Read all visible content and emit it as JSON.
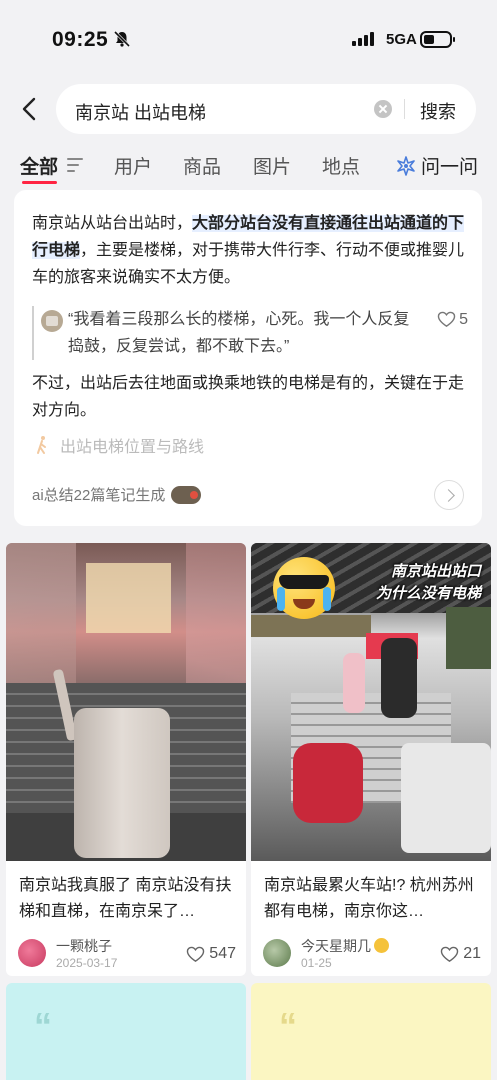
{
  "status_bar": {
    "time": "09:25",
    "network": "5GA"
  },
  "search": {
    "query": "南京站 出站电梯",
    "button_label": "搜索"
  },
  "tabs": [
    {
      "label": "全部"
    },
    {
      "label": "用户"
    },
    {
      "label": "商品"
    },
    {
      "label": "图片"
    },
    {
      "label": "地点"
    },
    {
      "label": "问一问"
    }
  ],
  "ai_summary": {
    "p1_before": "南京站从站台出站时，",
    "p1_highlight": "大部分站台没有直接通往出站通道的下行电梯",
    "p1_after": "，主要是楼梯，对于携带大件行李、行动不便或推婴儿车的旅客来说确实不太方便。",
    "quote_text": "“我看着三段那么长的楼梯，心死。我一个人反复捣鼓，反复尝试，都不敢下去。”",
    "quote_likes": "5",
    "p2": "不过，出站后去往地面或换乘地铁的电梯是有的，关键在于走对方向。",
    "route_link": "出站电梯位置与路线",
    "footer": "ai总结22篇笔记生成"
  },
  "notes": [
    {
      "title": "南京站我真服了 南京站没有扶梯和直梯，在南京呆了…",
      "author": "一颗桃子",
      "date": "2025-03-17",
      "likes": "547"
    },
    {
      "overlay_line1": "南京站出站口",
      "overlay_line2": "为什么没有电梯",
      "title": "南京站最累火车站!? 杭州苏州都有电梯，南京你这…",
      "author": "今天星期几",
      "date": "01-25",
      "likes": "21"
    }
  ],
  "bottom_cards": [
    {
      "mark": "“"
    },
    {
      "mark": "“"
    }
  ],
  "colors": {
    "accent": "#ff2442",
    "highlight_bg": "#e6efff",
    "card3_bg": "#c8f2f2",
    "card4_bg": "#fbf6c2"
  }
}
